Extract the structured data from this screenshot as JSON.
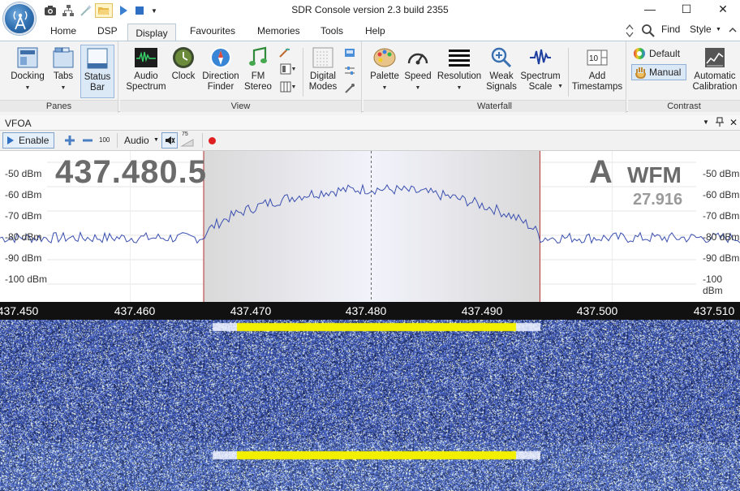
{
  "window": {
    "title": "SDR Console version 2.3 build 2355",
    "minimize": "—",
    "maximize": "☐",
    "close": "✕"
  },
  "menu": {
    "tabs": [
      "Home",
      "DSP",
      "Display",
      "Favourites",
      "Memories",
      "Tools",
      "Help"
    ],
    "active_tab": "Display",
    "find_label": "Find",
    "style_label": "Style"
  },
  "ribbon": {
    "panes": {
      "label": "Panes",
      "buttons": [
        "Docking",
        "Tabs",
        "Status Bar"
      ]
    },
    "view": {
      "label": "View",
      "buttons": [
        "Audio Spectrum",
        "Clock",
        "Direction Finder",
        "FM Stereo",
        "Digital Modes"
      ]
    },
    "waterfall": {
      "label": "Waterfall",
      "buttons": [
        "Palette",
        "Speed",
        "Resolution",
        "Weak Signals",
        "Spectrum Scale",
        "Add Timestamps"
      ]
    },
    "contrast": {
      "label": "Contrast",
      "default_label": "Default",
      "manual_label": "Manual",
      "auto_calibration_label": "Automatic Calibration"
    }
  },
  "vfo": {
    "title": "VFOA",
    "enable_label": "Enable",
    "step_value": "100",
    "audio_label": "Audio",
    "volume_value": "75",
    "frequency_display": "437.480.5",
    "vfo_letter": "A",
    "mode": "WFM",
    "bandwidth": "27.916"
  },
  "spectrum": {
    "dbm_labels": [
      "-50 dBm",
      "-60 dBm",
      "-70 dBm",
      "-80 dBm",
      "-90 dBm",
      "-100 dBm"
    ],
    "freq_ticks": [
      "437.450",
      "437.460",
      "437.470",
      "437.480",
      "437.490",
      "437.500",
      "437.510"
    ],
    "filter_low": 437.4661,
    "filter_high": 437.494,
    "center_freq": 437.48,
    "colors": {
      "trace": "#3a4fb0",
      "passband": "#e6e6f4",
      "filter_edge": "#b03030",
      "waterfall_bg": "#2a3f86",
      "signal": "#f2f000"
    }
  }
}
